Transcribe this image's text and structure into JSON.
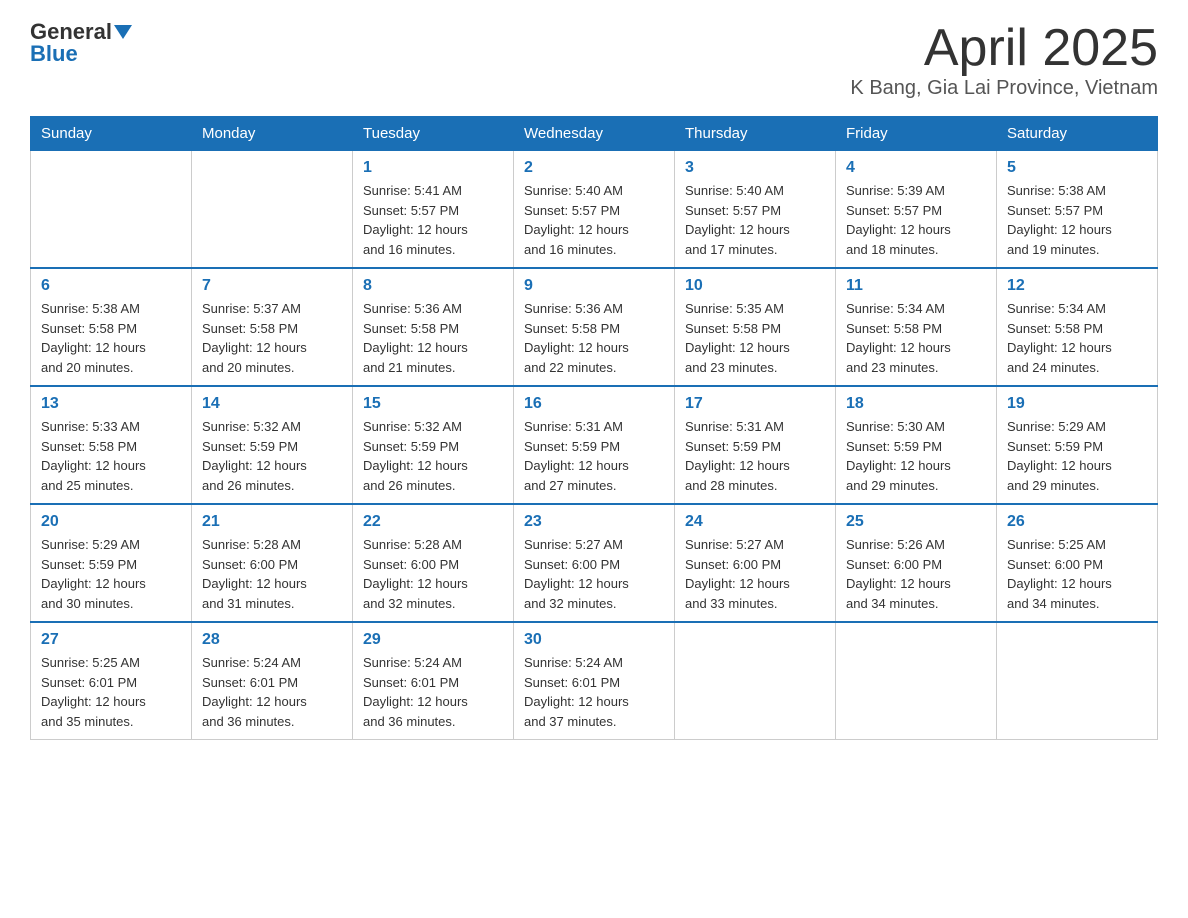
{
  "header": {
    "logo_line1": "General",
    "logo_line2": "Blue",
    "title": "April 2025",
    "subtitle": "K Bang, Gia Lai Province, Vietnam"
  },
  "days_of_week": [
    "Sunday",
    "Monday",
    "Tuesday",
    "Wednesday",
    "Thursday",
    "Friday",
    "Saturday"
  ],
  "weeks": [
    [
      {
        "day": "",
        "info": ""
      },
      {
        "day": "",
        "info": ""
      },
      {
        "day": "1",
        "info": "Sunrise: 5:41 AM\nSunset: 5:57 PM\nDaylight: 12 hours\nand 16 minutes."
      },
      {
        "day": "2",
        "info": "Sunrise: 5:40 AM\nSunset: 5:57 PM\nDaylight: 12 hours\nand 16 minutes."
      },
      {
        "day": "3",
        "info": "Sunrise: 5:40 AM\nSunset: 5:57 PM\nDaylight: 12 hours\nand 17 minutes."
      },
      {
        "day": "4",
        "info": "Sunrise: 5:39 AM\nSunset: 5:57 PM\nDaylight: 12 hours\nand 18 minutes."
      },
      {
        "day": "5",
        "info": "Sunrise: 5:38 AM\nSunset: 5:57 PM\nDaylight: 12 hours\nand 19 minutes."
      }
    ],
    [
      {
        "day": "6",
        "info": "Sunrise: 5:38 AM\nSunset: 5:58 PM\nDaylight: 12 hours\nand 20 minutes."
      },
      {
        "day": "7",
        "info": "Sunrise: 5:37 AM\nSunset: 5:58 PM\nDaylight: 12 hours\nand 20 minutes."
      },
      {
        "day": "8",
        "info": "Sunrise: 5:36 AM\nSunset: 5:58 PM\nDaylight: 12 hours\nand 21 minutes."
      },
      {
        "day": "9",
        "info": "Sunrise: 5:36 AM\nSunset: 5:58 PM\nDaylight: 12 hours\nand 22 minutes."
      },
      {
        "day": "10",
        "info": "Sunrise: 5:35 AM\nSunset: 5:58 PM\nDaylight: 12 hours\nand 23 minutes."
      },
      {
        "day": "11",
        "info": "Sunrise: 5:34 AM\nSunset: 5:58 PM\nDaylight: 12 hours\nand 23 minutes."
      },
      {
        "day": "12",
        "info": "Sunrise: 5:34 AM\nSunset: 5:58 PM\nDaylight: 12 hours\nand 24 minutes."
      }
    ],
    [
      {
        "day": "13",
        "info": "Sunrise: 5:33 AM\nSunset: 5:58 PM\nDaylight: 12 hours\nand 25 minutes."
      },
      {
        "day": "14",
        "info": "Sunrise: 5:32 AM\nSunset: 5:59 PM\nDaylight: 12 hours\nand 26 minutes."
      },
      {
        "day": "15",
        "info": "Sunrise: 5:32 AM\nSunset: 5:59 PM\nDaylight: 12 hours\nand 26 minutes."
      },
      {
        "day": "16",
        "info": "Sunrise: 5:31 AM\nSunset: 5:59 PM\nDaylight: 12 hours\nand 27 minutes."
      },
      {
        "day": "17",
        "info": "Sunrise: 5:31 AM\nSunset: 5:59 PM\nDaylight: 12 hours\nand 28 minutes."
      },
      {
        "day": "18",
        "info": "Sunrise: 5:30 AM\nSunset: 5:59 PM\nDaylight: 12 hours\nand 29 minutes."
      },
      {
        "day": "19",
        "info": "Sunrise: 5:29 AM\nSunset: 5:59 PM\nDaylight: 12 hours\nand 29 minutes."
      }
    ],
    [
      {
        "day": "20",
        "info": "Sunrise: 5:29 AM\nSunset: 5:59 PM\nDaylight: 12 hours\nand 30 minutes."
      },
      {
        "day": "21",
        "info": "Sunrise: 5:28 AM\nSunset: 6:00 PM\nDaylight: 12 hours\nand 31 minutes."
      },
      {
        "day": "22",
        "info": "Sunrise: 5:28 AM\nSunset: 6:00 PM\nDaylight: 12 hours\nand 32 minutes."
      },
      {
        "day": "23",
        "info": "Sunrise: 5:27 AM\nSunset: 6:00 PM\nDaylight: 12 hours\nand 32 minutes."
      },
      {
        "day": "24",
        "info": "Sunrise: 5:27 AM\nSunset: 6:00 PM\nDaylight: 12 hours\nand 33 minutes."
      },
      {
        "day": "25",
        "info": "Sunrise: 5:26 AM\nSunset: 6:00 PM\nDaylight: 12 hours\nand 34 minutes."
      },
      {
        "day": "26",
        "info": "Sunrise: 5:25 AM\nSunset: 6:00 PM\nDaylight: 12 hours\nand 34 minutes."
      }
    ],
    [
      {
        "day": "27",
        "info": "Sunrise: 5:25 AM\nSunset: 6:01 PM\nDaylight: 12 hours\nand 35 minutes."
      },
      {
        "day": "28",
        "info": "Sunrise: 5:24 AM\nSunset: 6:01 PM\nDaylight: 12 hours\nand 36 minutes."
      },
      {
        "day": "29",
        "info": "Sunrise: 5:24 AM\nSunset: 6:01 PM\nDaylight: 12 hours\nand 36 minutes."
      },
      {
        "day": "30",
        "info": "Sunrise: 5:24 AM\nSunset: 6:01 PM\nDaylight: 12 hours\nand 37 minutes."
      },
      {
        "day": "",
        "info": ""
      },
      {
        "day": "",
        "info": ""
      },
      {
        "day": "",
        "info": ""
      }
    ]
  ]
}
